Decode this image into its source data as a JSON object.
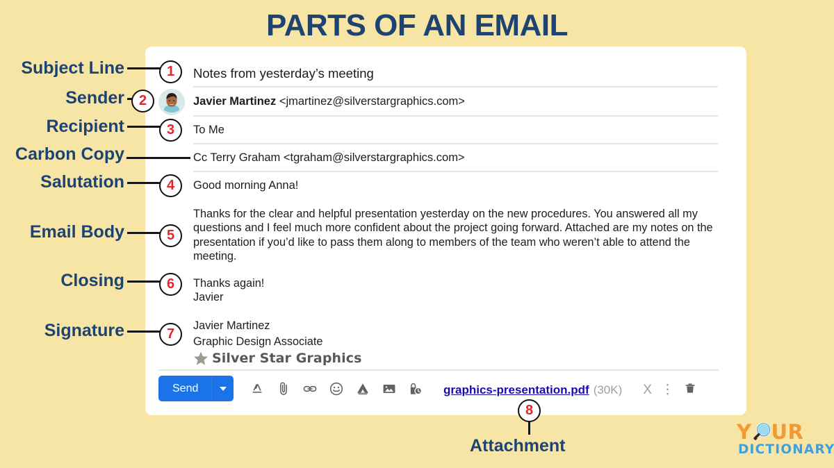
{
  "page": {
    "title": "PARTS OF AN EMAIL",
    "background_color": "#f7e5a6",
    "title_color": "#1d4372",
    "accent_number_color": "#e8232a"
  },
  "annotations": [
    {
      "number": "1",
      "label": "Subject Line"
    },
    {
      "number": "2",
      "label": "Sender"
    },
    {
      "number": "3",
      "label": "Recipient"
    },
    {
      "number": "",
      "label": "Carbon Copy"
    },
    {
      "number": "4",
      "label": "Salutation"
    },
    {
      "number": "5",
      "label": "Email Body"
    },
    {
      "number": "6",
      "label": "Closing"
    },
    {
      "number": "7",
      "label": "Signature"
    },
    {
      "number": "8",
      "label": "Attachment"
    }
  ],
  "email": {
    "subject": "Notes from yesterday’s meeting",
    "sender_name": "Javier Martinez",
    "sender_address": "<jmartinez@silverstargraphics.com>",
    "recipient": "To Me",
    "cc": "Cc Terry Graham <tgraham@silverstargraphics.com>",
    "salutation": "Good morning Anna!",
    "body": "Thanks for the clear and helpful presentation yesterday on the new procedures. You answered all my questions and I feel much more confident about the project going forward. Attached are my notes on the presentation if you’d like to pass them along to members of the team who weren’t able to attend the meeting.",
    "closing_line1": "Thanks again!",
    "closing_line2": "Javier",
    "signature_name": "Javier Martinez",
    "signature_role": "Graphic Design Associate",
    "signature_company": "Silver Star Graphics"
  },
  "toolbar": {
    "send_label": "Send",
    "send_color": "#1a73e8",
    "icons": [
      "format-text-icon",
      "attach-file-icon",
      "insert-link-icon",
      "insert-emoji-icon",
      "google-drive-icon",
      "insert-photo-icon",
      "schedule-send-icon"
    ]
  },
  "attachment": {
    "filename": "graphics-presentation.pdf",
    "size": "(30K)",
    "close_glyph": "X",
    "more_glyph": "⋮",
    "delete_icon": "trash-icon",
    "link_color": "#1a0dab"
  },
  "logo": {
    "word_top_left": "Y",
    "word_top_right": "UR",
    "word_bottom": "DICTIONARY",
    "color_top": "#f29a32",
    "color_bottom": "#3da0dd"
  }
}
